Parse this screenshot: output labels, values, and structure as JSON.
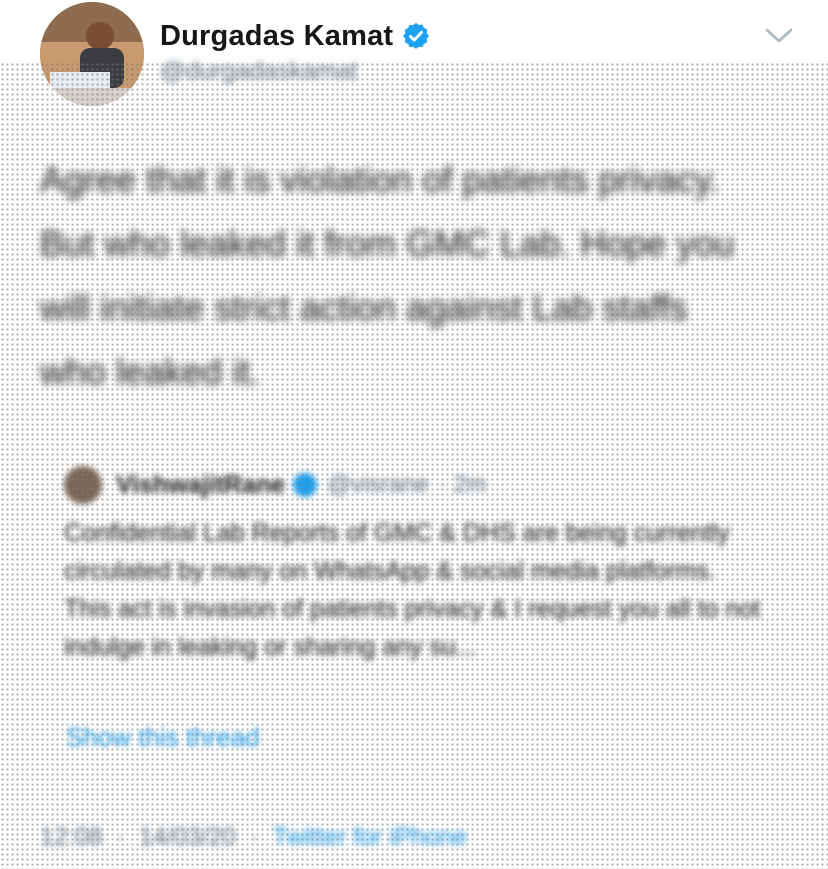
{
  "author": {
    "display_name": "Durgadas Kamat",
    "handle": "@durgadaskamat",
    "verified": true
  },
  "tweet": {
    "text": "Agree that it is violation of patients privacy. But who leaked it from GMC Lab. Hope you will initiate strict action against Lab staffs who leaked it."
  },
  "quoted_tweet": {
    "name": "VishwajitRane",
    "handle": "@visrane",
    "time": "· 2m",
    "body_lines": [
      "Confidential Lab Reports of GMC & DHS are being currently circulated by many on WhatsApp & social media platforms.",
      "This act is invasion of patients privacy & I request you all to not indulge in leaking or sharing any su..."
    ]
  },
  "show_thread_label": "Show this thread",
  "meta": {
    "time": "12:08",
    "date": "14/03/20",
    "separator": "·",
    "source": "Twitter for iPhone"
  },
  "colors": {
    "accent": "#1da1f2",
    "text": "#14171a",
    "secondary": "#657786"
  },
  "icons": {
    "verified": "verified-badge-icon",
    "menu": "chevron-down-icon"
  }
}
